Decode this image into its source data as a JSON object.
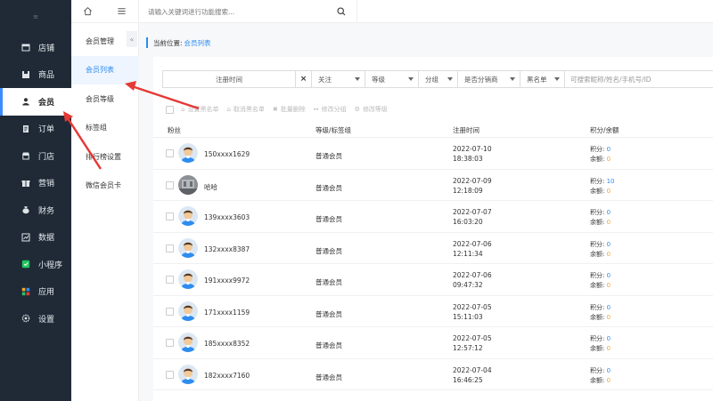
{
  "sidebar": {
    "top_label": "≡",
    "items": [
      {
        "label": "店铺",
        "icon": "store-icon"
      },
      {
        "label": "商品",
        "icon": "goods-icon"
      },
      {
        "label": "会员",
        "icon": "member-icon"
      },
      {
        "label": "订单",
        "icon": "order-icon"
      },
      {
        "label": "门店",
        "icon": "shop-icon"
      },
      {
        "label": "营销",
        "icon": "marketing-icon"
      },
      {
        "label": "财务",
        "icon": "finance-icon"
      },
      {
        "label": "数据",
        "icon": "data-icon"
      },
      {
        "label": "小程序",
        "icon": "miniprogram-icon"
      },
      {
        "label": "应用",
        "icon": "apps-icon"
      },
      {
        "label": "设置",
        "icon": "settings-icon"
      }
    ],
    "active_index": 2
  },
  "subnav": {
    "items": [
      "会员管理",
      "会员列表",
      "会员等级",
      "标签组",
      "排行榜设置",
      "微信会员卡"
    ],
    "active_index": 1,
    "collapse_glyph": "«"
  },
  "header": {
    "search_placeholder": "请输入关键词进行功能搜索..."
  },
  "breadcrumb": {
    "prefix": "当前位置:",
    "current": "会员列表"
  },
  "filters": {
    "date_label": "注册时间",
    "clear_glyph": "×",
    "selects": [
      "关注",
      "等级",
      "分组",
      "是否分销商",
      "黑名单"
    ],
    "keyword_placeholder": "可搜索昵称/姓名/手机号/ID"
  },
  "actions": [
    {
      "label": "设置黑名单",
      "glyph": "⌂"
    },
    {
      "label": "取消黑名单",
      "glyph": "⌂"
    },
    {
      "label": "批量删除",
      "glyph": "✖"
    },
    {
      "label": "修改分组",
      "glyph": "↔"
    },
    {
      "label": "修改等级",
      "glyph": "⚙"
    }
  ],
  "table": {
    "headers": {
      "fans": "粉丝",
      "level": "等级/标签组",
      "register_time": "注册时间",
      "points_balance": "积分/余额"
    },
    "points_label": "积分:",
    "balance_label": "余额:",
    "rows": [
      {
        "name": "150xxxx1629",
        "level": "普通会员",
        "date": "2022-07-10",
        "time": "18:38:03",
        "points": "0",
        "balance": "0",
        "avatar": "default-avatar"
      },
      {
        "name": "哈哈",
        "level": "普通会员",
        "date": "2022-07-09",
        "time": "12:18:09",
        "points": "10",
        "balance": "0",
        "avatar": "photo-avatar"
      },
      {
        "name": "139xxxx3603",
        "level": "普通会员",
        "date": "2022-07-07",
        "time": "16:03:20",
        "points": "0",
        "balance": "0",
        "avatar": "default-avatar"
      },
      {
        "name": "132xxxx8387",
        "level": "普通会员",
        "date": "2022-07-06",
        "time": "12:11:34",
        "points": "0",
        "balance": "0",
        "avatar": "default-avatar"
      },
      {
        "name": "191xxxx9972",
        "level": "普通会员",
        "date": "2022-07-06",
        "time": "09:47:32",
        "points": "0",
        "balance": "0",
        "avatar": "default-avatar"
      },
      {
        "name": "171xxxx1159",
        "level": "普通会员",
        "date": "2022-07-05",
        "time": "15:11:03",
        "points": "0",
        "balance": "0",
        "avatar": "default-avatar"
      },
      {
        "name": "185xxxx8352",
        "level": "普通会员",
        "date": "2022-07-05",
        "time": "12:57:12",
        "points": "0",
        "balance": "0",
        "avatar": "default-avatar"
      },
      {
        "name": "182xxxx7160",
        "level": "普通会员",
        "date": "2022-07-04",
        "time": "16:46:25",
        "points": "0",
        "balance": "0",
        "avatar": "default-avatar"
      }
    ]
  },
  "colors": {
    "sidebar_bg": "#1f2a36",
    "accent": "#2d8cf0",
    "balance": "#f5a623",
    "annotation_arrow": "#e53935"
  }
}
